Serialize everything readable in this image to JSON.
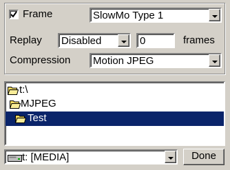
{
  "options": {
    "frame_label": "Frame",
    "frame_checked": true,
    "frame_mode_value": "SlowMo Type 1",
    "replay_label": "Replay",
    "replay_value": "Disabled",
    "replay_frames_value": "0",
    "frames_label": "frames",
    "compression_label": "Compression",
    "compression_value": "Motion JPEG"
  },
  "tree": {
    "items": [
      {
        "label": "t:\\",
        "icon": "folder-open-icon"
      },
      {
        "label": "MJPEG",
        "icon": "folder-open-icon"
      },
      {
        "label": "Test",
        "icon": "folder-open-icon",
        "selected": true
      }
    ]
  },
  "bottom": {
    "drive_value": "t: [MEDIA]",
    "drive_icon": "drive-icon",
    "done_label": "Done"
  },
  "colors": {
    "window_bg": "#d4d0c8",
    "selection_bg": "#0a246a",
    "folder_yellow": "#f0d860"
  }
}
